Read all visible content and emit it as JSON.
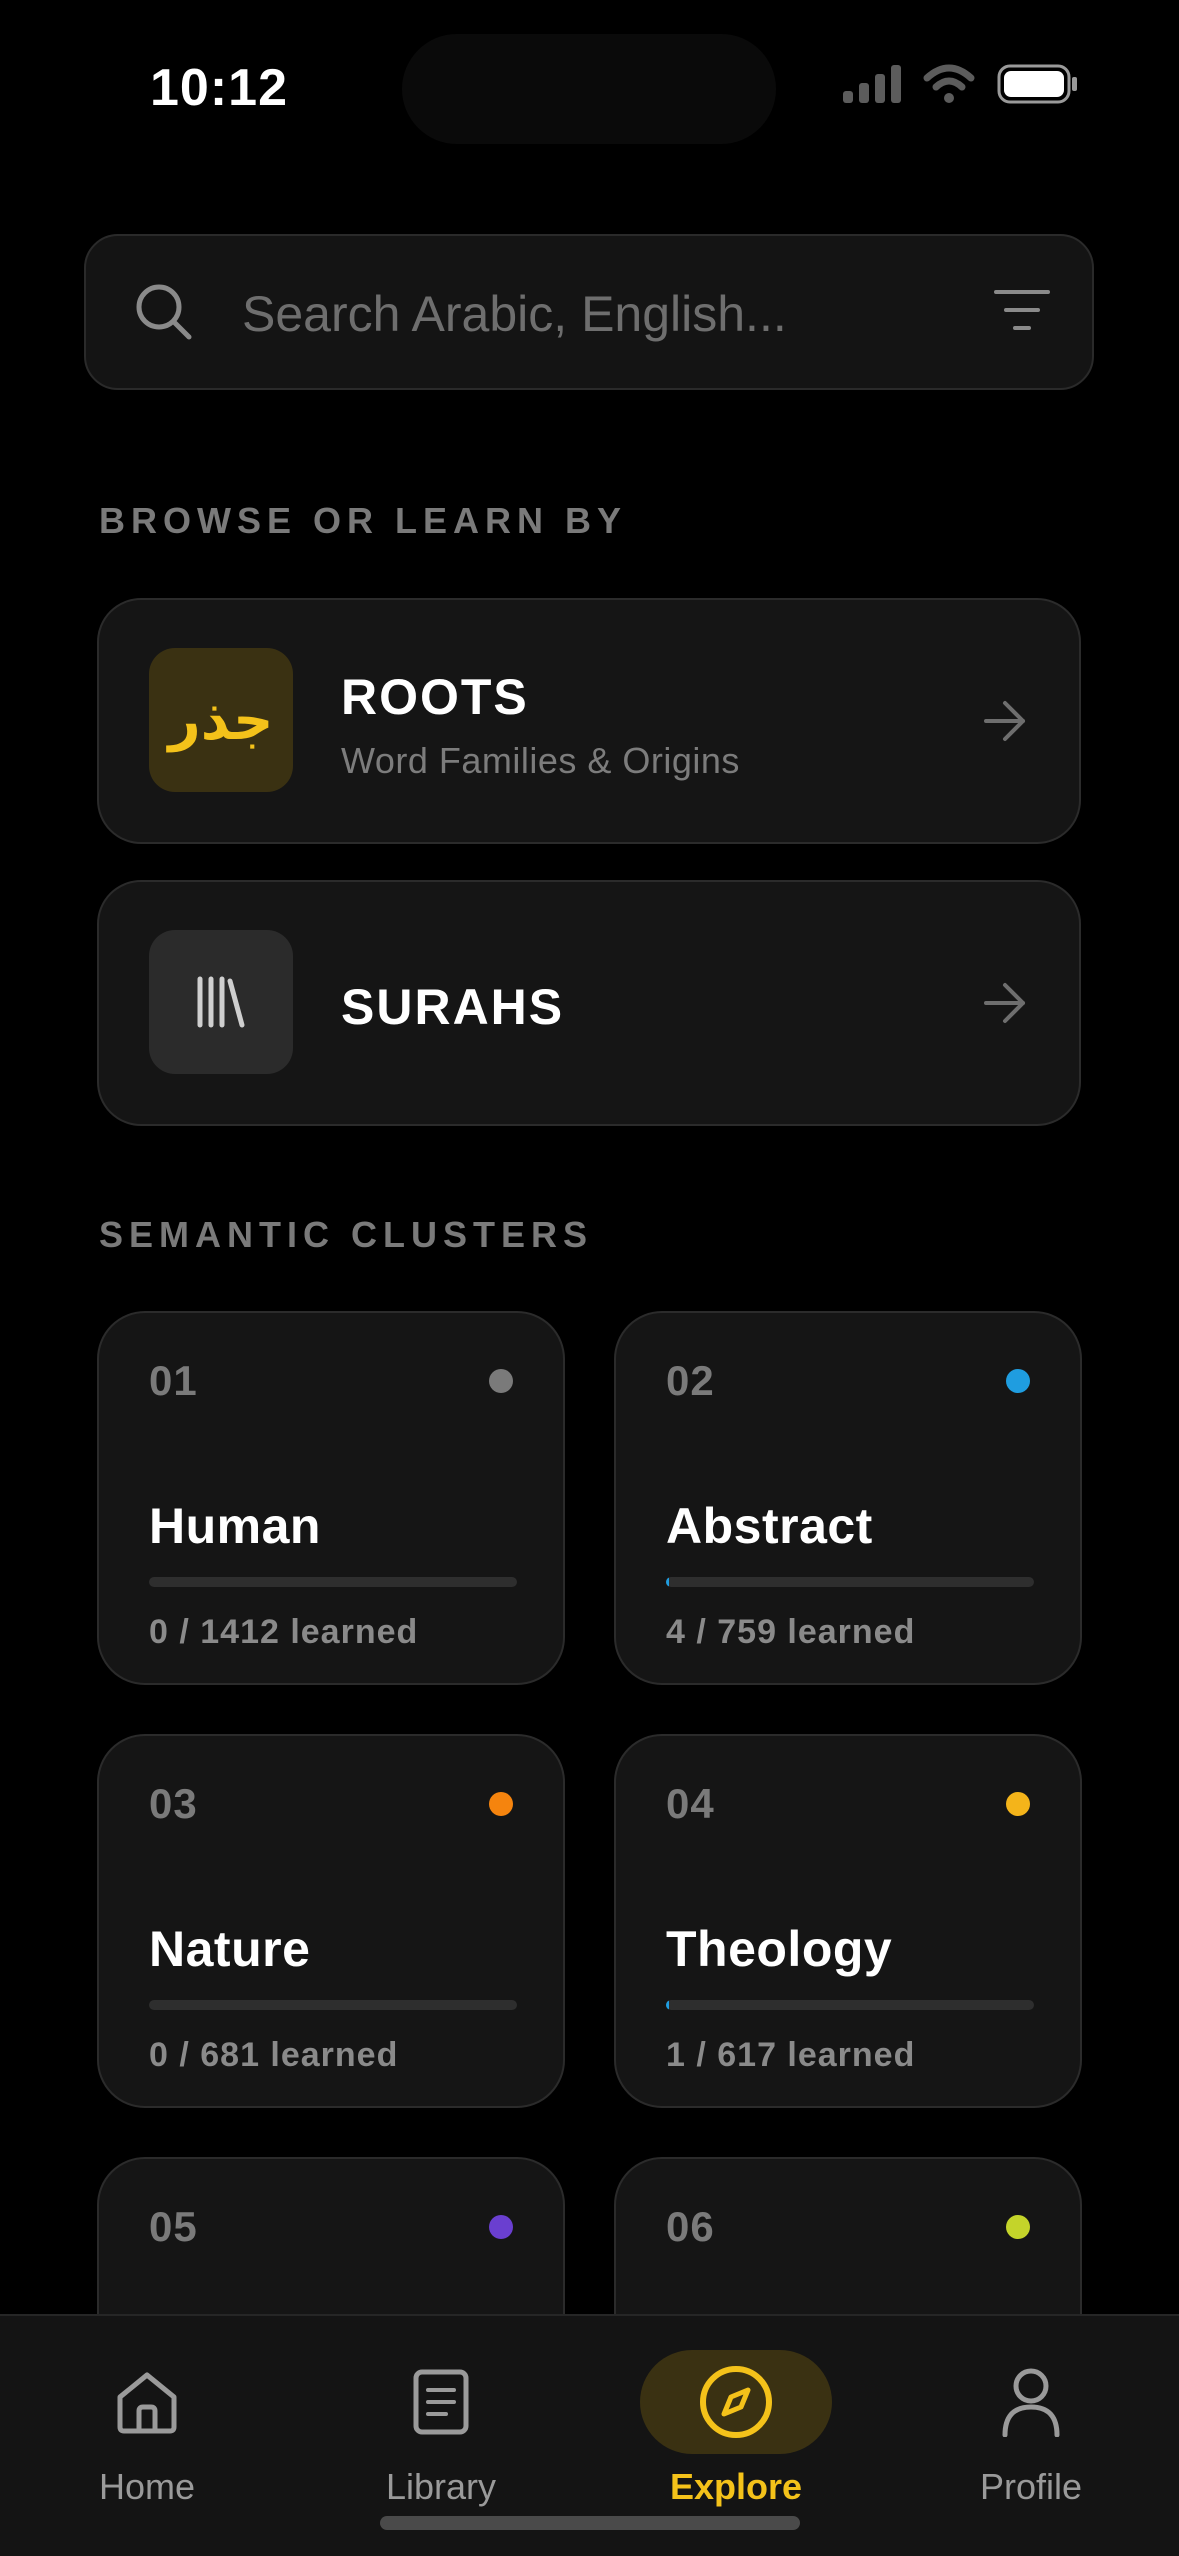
{
  "status": {
    "time": "10:12"
  },
  "search": {
    "placeholder": "Search Arabic, English..."
  },
  "browse": {
    "label": "BROWSE OR LEARN BY",
    "items": [
      {
        "title": "ROOTS",
        "subtitle": "Word Families & Origins",
        "tile_text": "جذر",
        "icon": "arabic-root-glyph-icon"
      },
      {
        "title": "SURAHS",
        "icon": "books-icon"
      }
    ]
  },
  "clusters": {
    "label": "SEMANTIC CLUSTERS",
    "items": [
      {
        "num": "01",
        "name": "Human",
        "count": "0 / 1412 learned",
        "dot_color": "#7a7a7a",
        "progress": 0.0
      },
      {
        "num": "02",
        "name": "Abstract",
        "count": "4 / 759 learned",
        "dot_color": "#1f9de0",
        "progress": 0.005
      },
      {
        "num": "03",
        "name": "Nature",
        "count": "0 / 681 learned",
        "dot_color": "#f5840e",
        "progress": 0.0
      },
      {
        "num": "04",
        "name": "Theology",
        "count": "1 / 617 learned",
        "dot_color": "#f4b41a",
        "progress": 0.002
      },
      {
        "num": "05",
        "dot_color": "#6a3fd0"
      },
      {
        "num": "06",
        "dot_color": "#c4d42a"
      }
    ]
  },
  "tabs": [
    {
      "label": "Home",
      "icon": "home-icon"
    },
    {
      "label": "Library",
      "icon": "document-icon"
    },
    {
      "label": "Explore",
      "icon": "compass-icon",
      "active": true
    },
    {
      "label": "Profile",
      "icon": "person-icon"
    }
  ],
  "colors": {
    "accent": "#f4c21a",
    "background": "#000000",
    "card": "#151515"
  }
}
